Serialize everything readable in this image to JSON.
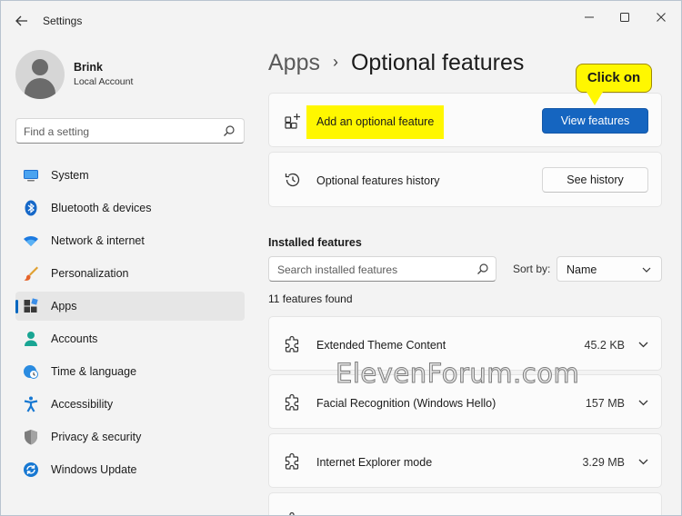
{
  "window": {
    "title": "Settings"
  },
  "profile": {
    "name": "Brink",
    "account_type": "Local Account"
  },
  "search": {
    "placeholder": "Find a setting"
  },
  "sidebar": {
    "items": [
      {
        "label": "System",
        "icon": "system-icon"
      },
      {
        "label": "Bluetooth & devices",
        "icon": "bluetooth-icon"
      },
      {
        "label": "Network & internet",
        "icon": "wifi-icon"
      },
      {
        "label": "Personalization",
        "icon": "brush-icon"
      },
      {
        "label": "Apps",
        "icon": "apps-icon",
        "selected": true
      },
      {
        "label": "Accounts",
        "icon": "person-icon"
      },
      {
        "label": "Time & language",
        "icon": "clock-globe-icon"
      },
      {
        "label": "Accessibility",
        "icon": "accessibility-icon"
      },
      {
        "label": "Privacy & security",
        "icon": "shield-icon"
      },
      {
        "label": "Windows Update",
        "icon": "update-icon"
      }
    ]
  },
  "breadcrumb": {
    "parent": "Apps",
    "current": "Optional features"
  },
  "add_feature": {
    "label": "Add an optional feature",
    "button": "View features"
  },
  "history": {
    "label": "Optional features history",
    "button": "See history"
  },
  "callout": {
    "text": "Click on"
  },
  "installed": {
    "title": "Installed features",
    "search_placeholder": "Search installed features",
    "sort_label": "Sort by:",
    "sort_value": "Name",
    "count_text": "11 features found",
    "features": [
      {
        "name": "Extended Theme Content",
        "size": "45.2 KB"
      },
      {
        "name": "Facial Recognition (Windows Hello)",
        "size": "157 MB"
      },
      {
        "name": "Internet Explorer mode",
        "size": "3.29 MB"
      }
    ]
  },
  "watermark": {
    "text": "ElevenForum.com"
  },
  "colors": {
    "accent": "#1565c0",
    "highlight": "#fff700",
    "selected_indicator": "#0067c0"
  }
}
